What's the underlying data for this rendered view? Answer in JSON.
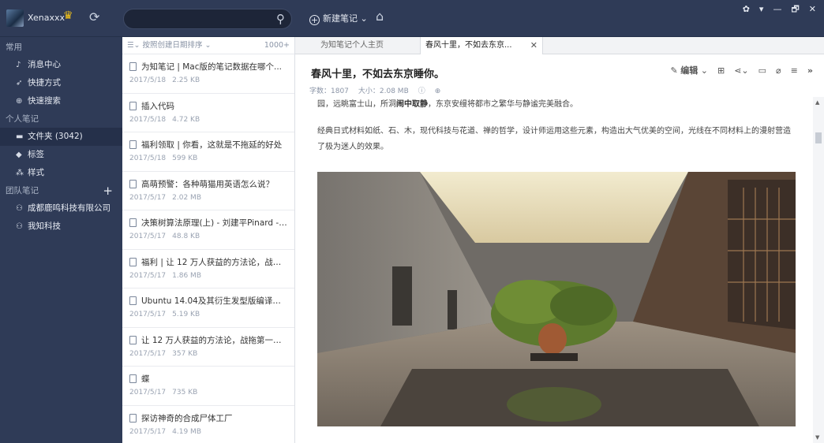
{
  "topbar": {
    "username": "Xenaxxx",
    "new_note_label": "新建笔记",
    "search_placeholder": "",
    "window_controls": [
      "▾",
      "—",
      "🗗",
      "✕"
    ]
  },
  "sidebar": {
    "section_common": "常用",
    "items_common": [
      {
        "label": "消息中心",
        "icon": "bell-icon"
      },
      {
        "label": "快捷方式",
        "icon": "rocket-icon"
      },
      {
        "label": "快速搜索",
        "icon": "search-icon"
      }
    ],
    "section_personal": "个人笔记",
    "items_personal": [
      {
        "label": "文件夹 (3042)",
        "icon": "folder-icon"
      },
      {
        "label": "标签",
        "icon": "tag-icon"
      },
      {
        "label": "样式",
        "icon": "style-icon"
      }
    ],
    "section_team": "团队笔记",
    "items_team": [
      {
        "label": "成都鹿鸣科技有限公司",
        "icon": "team-icon"
      },
      {
        "label": "我知科技",
        "icon": "team-icon"
      }
    ]
  },
  "notelist": {
    "sort_label": "按照创建日期排序",
    "count": "1000+",
    "notes": [
      {
        "title": "为知笔记 | Mac版的笔记数据在哪个...",
        "date": "2017/5/18",
        "size": "2.25 KB"
      },
      {
        "title": "插入代码",
        "date": "2017/5/18",
        "size": "4.72 KB"
      },
      {
        "title": "福利领取 | 你看，这就是不拖延的好处",
        "date": "2017/5/18",
        "size": "599 KB"
      },
      {
        "title": "高萌预警：各种萌猫用英语怎么说？",
        "date": "2017/5/17",
        "size": "2.02 MB"
      },
      {
        "title": "决策树算法原理(上) - 刘建平Pinard - ...",
        "date": "2017/5/17",
        "size": "48.8 KB"
      },
      {
        "title": "福利 | 让 12 万人获益的方法论，战拖...",
        "date": "2017/5/17",
        "size": "1.86 MB"
      },
      {
        "title": "Ubuntu 14.04及其衍生发型版编译为...",
        "date": "2017/5/17",
        "size": "5.19 KB"
      },
      {
        "title": "让 12 万人获益的方法论，战拖第一人...",
        "date": "2017/5/17",
        "size": "357 KB"
      },
      {
        "title": "蝶",
        "date": "2017/5/17",
        "size": "735 KB"
      },
      {
        "title": "探访神奇的合成尸体工厂",
        "date": "2017/5/17",
        "size": "4.19 MB"
      }
    ]
  },
  "tabs": [
    {
      "label": "为知笔记个人主页"
    },
    {
      "label": "春风十里，不如去东京..."
    }
  ],
  "doc": {
    "title": "春风十里，不如去东京睡你。",
    "edit_label": "编辑",
    "word_count": "字数：1807",
    "size": "大小：2.08 MB",
    "para1_pre": "园，远眺富士山，所洞",
    "para1_bold": "闹中取静",
    "para1_post": "，东京安缦将都市之繁华与静谧完美融合。",
    "para2": "经典日式材料如纸、石、木，现代科技与花道、禅的哲学，设计师运用这些元素，构造出大气优美的空间，光线在不同材料上的漫射营造了极为迷人的效果。"
  },
  "colors": {
    "chrome": "#2f3b57",
    "accent": "#f5c518"
  }
}
